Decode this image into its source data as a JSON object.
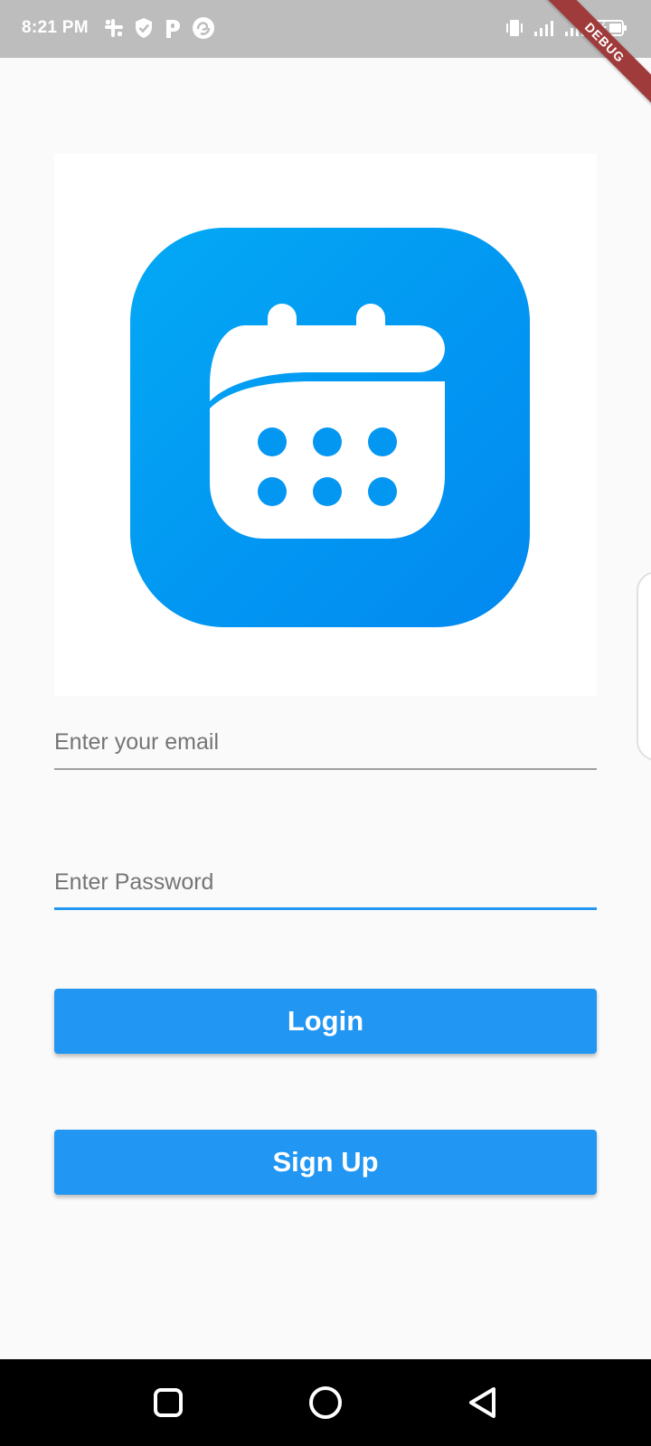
{
  "status_bar": {
    "time": "8:21 PM",
    "left_icons": [
      "slack-icon",
      "shield-check-icon",
      "parking-p-icon",
      "swirl-app-icon"
    ],
    "right_icons": [
      "vibrate-icon",
      "signal-icon",
      "signal-icon",
      "battery-charging-icon"
    ]
  },
  "debug_banner": "DEBUG",
  "logo": {
    "icon": "calendar-icon",
    "gradient_start": "#03a9f4",
    "gradient_end": "#0288f0"
  },
  "form": {
    "email_placeholder": "Enter your email",
    "password_placeholder": "Enter Password"
  },
  "buttons": {
    "login_label": "Login",
    "signup_label": "Sign Up",
    "color": "#2196f3"
  },
  "nav_bar": {
    "items": [
      "recents-square-icon",
      "home-circle-icon",
      "back-triangle-icon"
    ]
  }
}
